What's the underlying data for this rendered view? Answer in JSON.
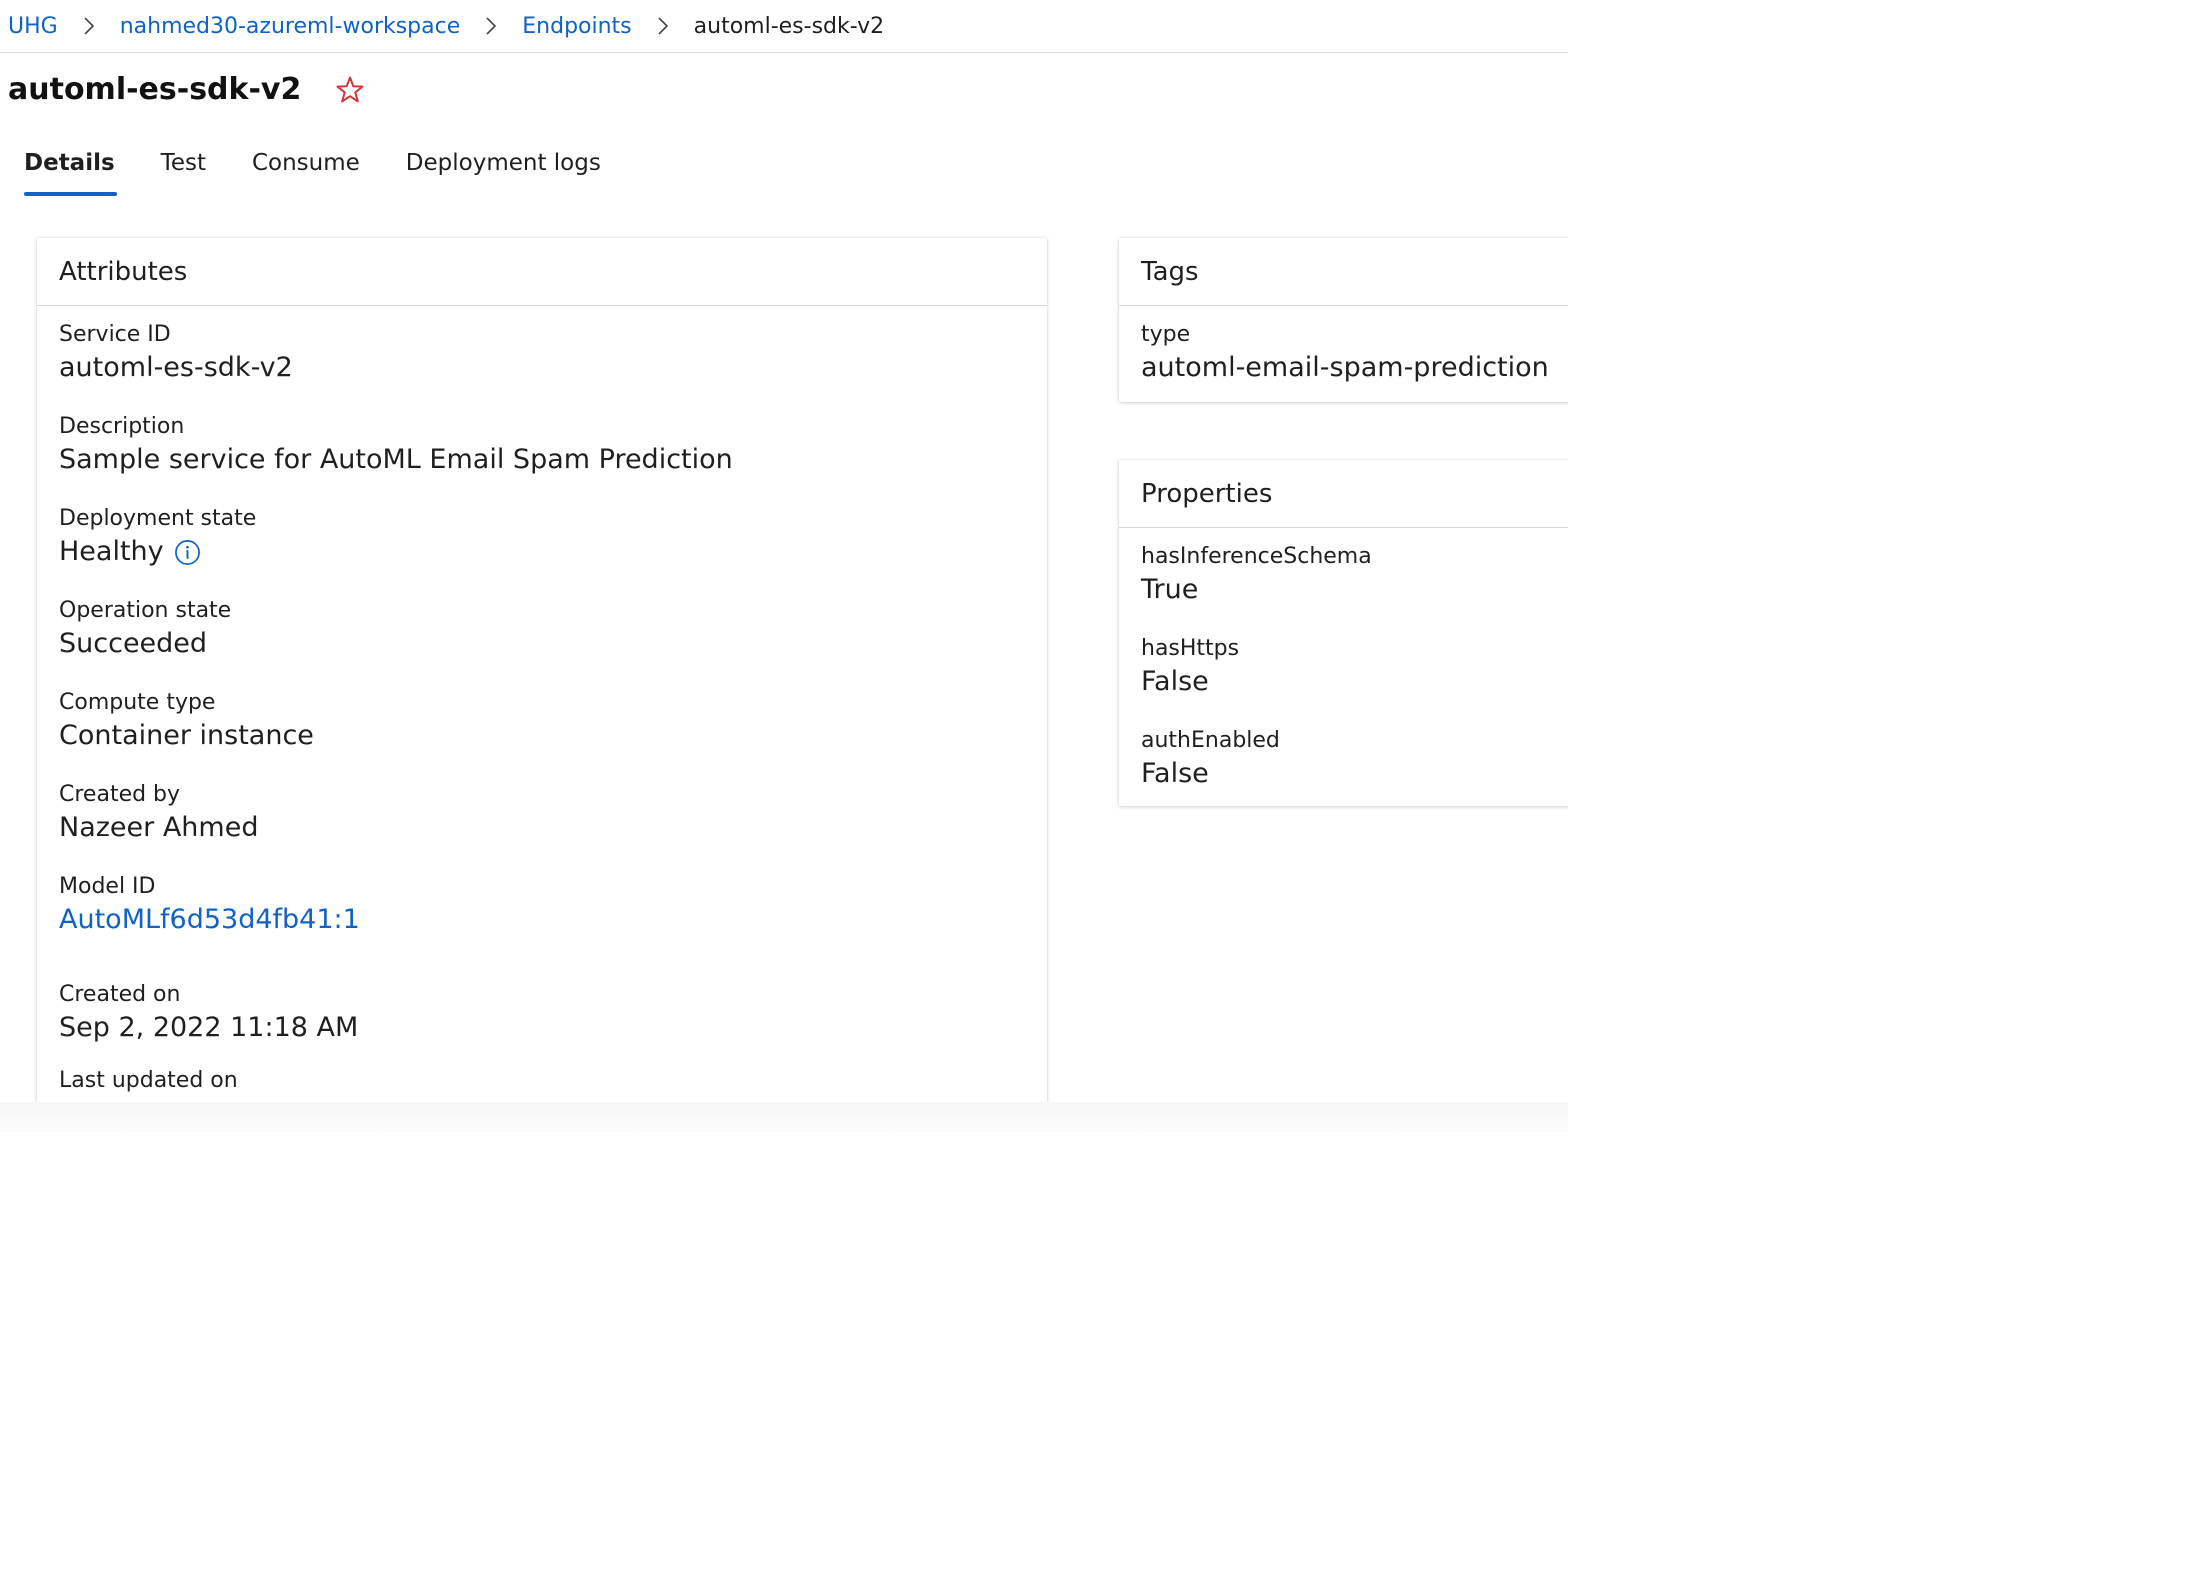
{
  "breadcrumb": {
    "items": [
      "UHG",
      "nahmed30-azureml-workspace",
      "Endpoints"
    ],
    "current": "automl-es-sdk-v2"
  },
  "page": {
    "title": "automl-es-sdk-v2",
    "favorite_icon": "star-outline-icon"
  },
  "tabs": [
    {
      "label": "Details",
      "active": true
    },
    {
      "label": "Test",
      "active": false
    },
    {
      "label": "Consume",
      "active": false
    },
    {
      "label": "Deployment logs",
      "active": false
    }
  ],
  "attributes": {
    "header": "Attributes",
    "fields": [
      {
        "label": "Service ID",
        "value": "automl-es-sdk-v2"
      },
      {
        "label": "Description",
        "value": "Sample service for AutoML Email Spam Prediction"
      },
      {
        "label": "Deployment state",
        "value": "Healthy"
      },
      {
        "label": "Operation state",
        "value": "Succeeded"
      },
      {
        "label": "Compute type",
        "value": "Container instance"
      },
      {
        "label": "Created by",
        "value": "Nazeer Ahmed"
      },
      {
        "label": "Model ID",
        "value": "AutoMLf6d53d4fb41:1"
      },
      {
        "label": "Created on",
        "value": "Sep 2, 2022 11:18 AM"
      },
      {
        "label": "Last updated on",
        "value": ""
      }
    ]
  },
  "tags": {
    "header": "Tags",
    "fields": [
      {
        "label": "type",
        "value": "automl-email-spam-prediction"
      }
    ]
  },
  "properties": {
    "header": "Properties",
    "fields": [
      {
        "label": "hasInferenceSchema",
        "value": "True"
      },
      {
        "label": "hasHttps",
        "value": "False"
      },
      {
        "label": "authEnabled",
        "value": "False"
      }
    ]
  },
  "colors": {
    "link": "#0f62c6",
    "star": "#d13438",
    "tab_indicator": "#0f62c6"
  }
}
